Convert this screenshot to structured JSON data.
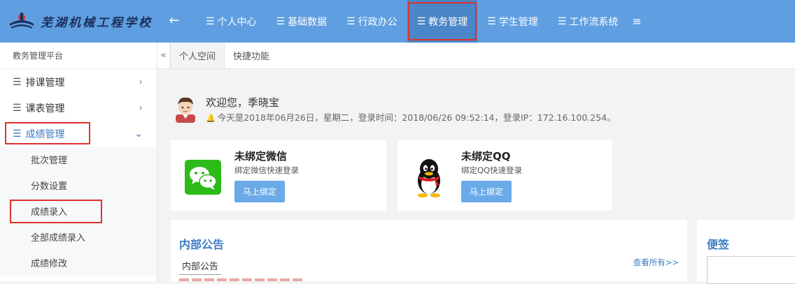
{
  "header": {
    "logo_text": "芜湖机械工程学校",
    "back_icon": "←",
    "nav": [
      {
        "label": "个人中心",
        "active": false
      },
      {
        "label": "基础数据",
        "active": false
      },
      {
        "label": "行政办公",
        "active": false
      },
      {
        "label": "教务管理",
        "active": true
      },
      {
        "label": "学生管理",
        "active": false
      },
      {
        "label": "工作流系统",
        "active": false
      }
    ],
    "more_icon": "≡"
  },
  "sidebar": {
    "title": "教务管理平台",
    "items": [
      {
        "label": "排课管理",
        "chevron": "›"
      },
      {
        "label": "课表管理",
        "chevron": "›"
      },
      {
        "label": "成绩管理",
        "chevron": "⌄"
      }
    ],
    "subitems": [
      {
        "label": "批次管理"
      },
      {
        "label": "分数设置"
      },
      {
        "label": "成绩录入"
      },
      {
        "label": "全部成绩录入"
      },
      {
        "label": "成绩修改"
      }
    ]
  },
  "tabs": {
    "collapse": "«",
    "items": [
      {
        "label": "个人空间",
        "active": true
      },
      {
        "label": "快捷功能",
        "active": false
      }
    ]
  },
  "welcome": {
    "greeting": "欢迎您，季晓宝",
    "info": "今天是2018年06月26日，星期二，登录时间：2018/06/26 09:52:14，登录IP：172.16.100.254。"
  },
  "wechat_card": {
    "title": "未绑定微信",
    "subtitle": "绑定微信快速登录",
    "button": "马上绑定"
  },
  "qq_card": {
    "title": "未绑定QQ",
    "subtitle": "绑定QQ快速登录",
    "button": "马上绑定"
  },
  "notice": {
    "title": "内部公告",
    "tab": "内部公告",
    "more": "查看所有>>"
  },
  "memo": {
    "title": "便签"
  },
  "colors": {
    "topbar": "#5f9fe1",
    "highlight": "#e0312d",
    "accent": "#3d7bc2"
  }
}
